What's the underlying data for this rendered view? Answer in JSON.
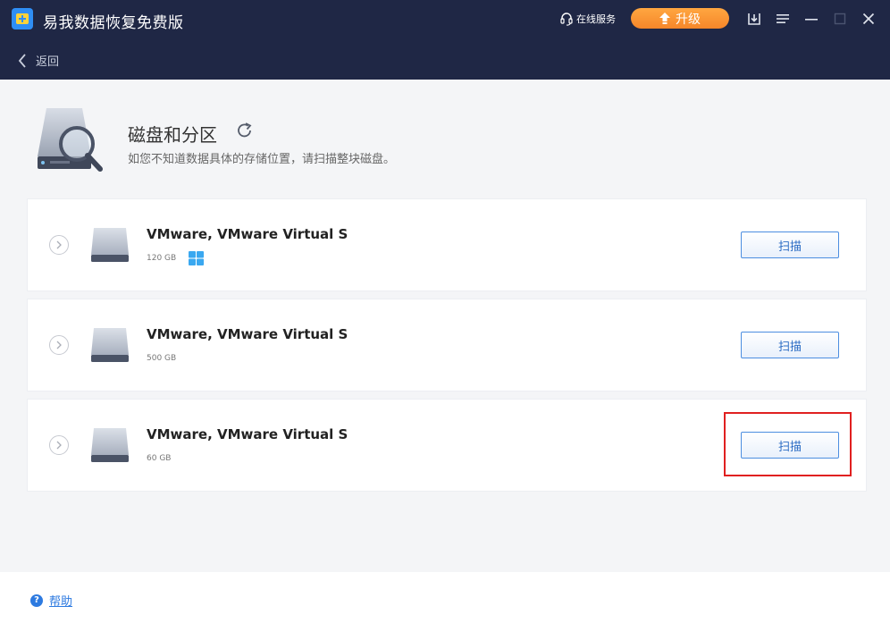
{
  "window": {
    "title": "易我数据恢复免费版",
    "online_service": "在线服务",
    "upgrade_label": "升级"
  },
  "nav": {
    "back_label": "返回"
  },
  "section": {
    "title": "磁盘和分区",
    "description": "如您不知道数据具体的存储位置，请扫描整块磁盘。"
  },
  "disks": [
    {
      "name": "VMware,  VMware Virtual S",
      "size": "120 GB",
      "has_windows": true,
      "scan_label": "扫描"
    },
    {
      "name": "VMware,  VMware Virtual S",
      "size": "500 GB",
      "has_windows": false,
      "scan_label": "扫描"
    },
    {
      "name": "VMware,  VMware Virtual S",
      "size": "60 GB",
      "has_windows": false,
      "scan_label": "扫描"
    }
  ],
  "footer": {
    "help_label": "帮助",
    "help_icon_glyph": "?"
  },
  "colors": {
    "titlebar": "#1f2745",
    "upgrade": "#f6862a",
    "accent": "#2d7ae0",
    "highlight": "#e02020"
  }
}
